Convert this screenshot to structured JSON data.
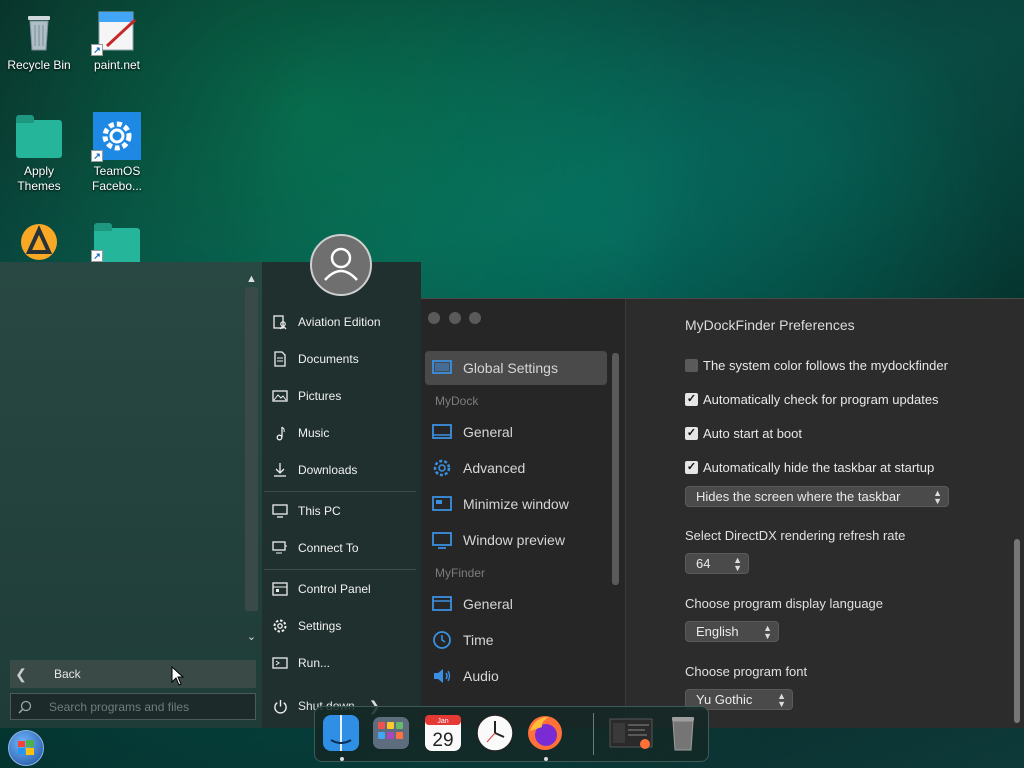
{
  "desktop": {
    "icons": [
      {
        "label": "Recycle Bin"
      },
      {
        "label": "paint.net"
      },
      {
        "label": "Apply Themes"
      },
      {
        "label": "TeamOS Facebo..."
      }
    ]
  },
  "start_menu": {
    "items": [
      {
        "label": "Aviation Edition",
        "icon": "user-folder-icon"
      },
      {
        "label": "Documents",
        "icon": "document-icon"
      },
      {
        "label": "Pictures",
        "icon": "picture-icon"
      },
      {
        "label": "Music",
        "icon": "music-note-icon"
      },
      {
        "label": "Downloads",
        "icon": "download-icon"
      },
      {
        "label": "This PC",
        "icon": "computer-icon"
      },
      {
        "label": "Connect To",
        "icon": "network-icon"
      },
      {
        "label": "Control Panel",
        "icon": "control-panel-icon"
      },
      {
        "label": "Settings",
        "icon": "gear-icon"
      },
      {
        "label": "Run...",
        "icon": "run-icon"
      }
    ],
    "back_label": "Back",
    "search_placeholder": "Search programs and files",
    "shutdown_label": "Shut down"
  },
  "prefs": {
    "title": "MyDockFinder Preferences",
    "nav": {
      "global": "Global Settings",
      "group_mydock": "MyDock",
      "mydock_items": [
        "General",
        "Advanced",
        "Minimize window",
        "Window preview"
      ],
      "group_myfinder": "MyFinder",
      "myfinder_items": [
        "General",
        "Time",
        "Audio"
      ]
    },
    "options": {
      "system_color": {
        "label": "The system color follows the mydockfinder",
        "checked": false
      },
      "auto_update": {
        "label": "Automatically check for program updates",
        "checked": true
      },
      "auto_start": {
        "label": "Auto start at boot",
        "checked": true
      },
      "auto_hide_taskbar": {
        "label": "Automatically hide the taskbar at startup",
        "checked": true
      }
    },
    "taskbar_mode": "Hides the screen where the taskbar",
    "refresh_label": "Select DirectDX rendering refresh rate",
    "refresh_value": "64",
    "language_label": "Choose program display language",
    "language_value": "English",
    "font_label": "Choose program font",
    "font_value": "Yu Gothic"
  },
  "dock": {
    "calendar_month": "Jan",
    "calendar_day": "29"
  }
}
